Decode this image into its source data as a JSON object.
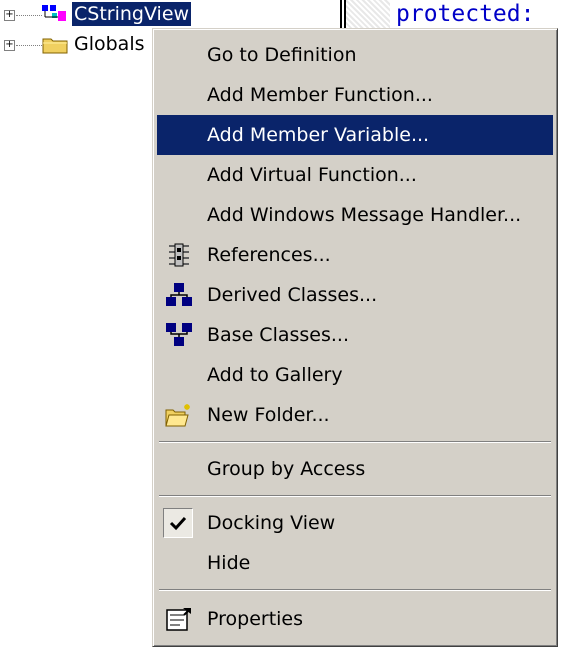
{
  "tree": {
    "items": [
      {
        "label": "CStringView",
        "expander": "+",
        "icon": "class-icon",
        "selected": true
      },
      {
        "label": "Globals",
        "expander": "+",
        "icon": "folder-icon",
        "selected": false
      }
    ]
  },
  "code": {
    "visible_text": "protected:"
  },
  "context_menu": {
    "items": [
      {
        "label": "Go to Definition",
        "mnemonic": "G"
      },
      {
        "label": "Add Member Function...",
        "mnemonic": "M"
      },
      {
        "label": "Add Member Variable...",
        "mnemonic": "V",
        "highlighted": true
      },
      {
        "label": "Add Virtual Function...",
        "mnemonic": "F"
      },
      {
        "label": "Add Windows Message Handler...",
        "mnemonic": "W"
      },
      {
        "label": "References...",
        "mnemonic": "f",
        "icon": "references-icon"
      },
      {
        "label": "Derived Classes...",
        "mnemonic": "i",
        "icon": "derived-classes-icon"
      },
      {
        "label": "Base Classes...",
        "mnemonic": "B",
        "icon": "base-classes-icon"
      },
      {
        "label": "Add to Gallery",
        "mnemonic": "y"
      },
      {
        "label": "New Folder...",
        "mnemonic": "w",
        "icon": "new-folder-icon"
      },
      {
        "label": "Group by Access",
        "mnemonic": "c"
      },
      {
        "label": "Docking View",
        "checked": true,
        "icon": "checkmark-icon"
      },
      {
        "label": "Hide",
        "mnemonic": "H"
      },
      {
        "label": "Properties",
        "mnemonic": "o",
        "icon": "properties-icon"
      }
    ]
  },
  "colors": {
    "menu_background": "#d4d0c8",
    "highlight": "#0a246a",
    "highlight_text": "#ffffff",
    "code_keyword": "#0000c8"
  }
}
